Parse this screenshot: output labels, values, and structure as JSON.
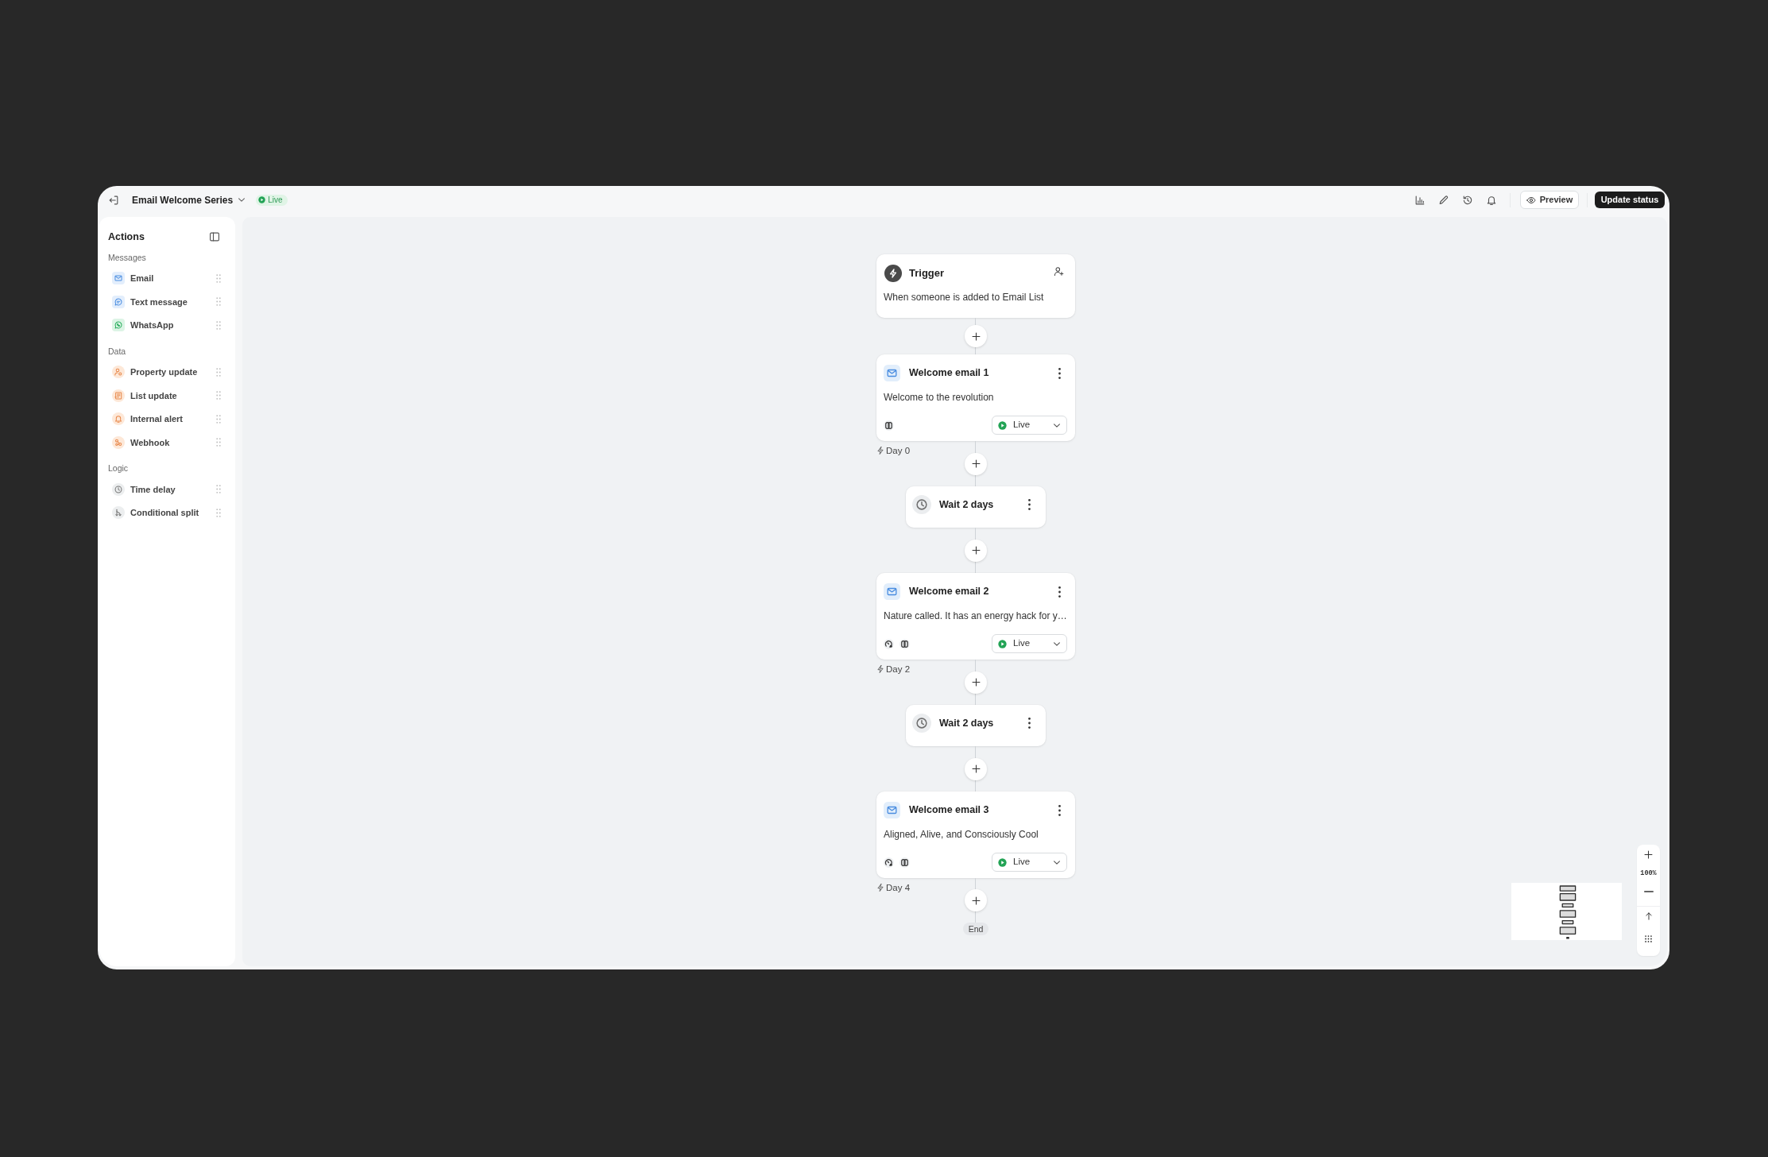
{
  "window": {
    "title": "Email Welcome Series",
    "status": "Live"
  },
  "toolbar": {
    "buttons": [
      {
        "label": "Preview",
        "kind": "preview"
      },
      {
        "label": "Update status",
        "kind": "primary"
      }
    ]
  },
  "sidebar": {
    "title": "Actions",
    "groups": [
      {
        "label": "Messages",
        "items": [
          {
            "label": "Email",
            "kind": "email"
          },
          {
            "label": "Text message",
            "kind": "sms"
          },
          {
            "label": "WhatsApp",
            "kind": "whatsapp"
          }
        ]
      },
      {
        "label": "Data",
        "items": [
          {
            "label": "Property update",
            "kind": "property"
          },
          {
            "label": "List update",
            "kind": "list"
          },
          {
            "label": "Internal alert",
            "kind": "alert"
          },
          {
            "label": "Webhook",
            "kind": "webhook"
          }
        ]
      },
      {
        "label": "Logic",
        "items": [
          {
            "label": "Time delay",
            "kind": "delay"
          },
          {
            "label": "Conditional split",
            "kind": "split"
          }
        ]
      }
    ]
  },
  "flow": {
    "nodes": [
      {
        "kind": "trigger",
        "title": "Trigger",
        "description": "When someone is added to Email List"
      },
      {
        "kind": "email",
        "title": "Welcome email 1",
        "description": "Welcome to the revolution",
        "indicators": [
          {
            "kind": "rings"
          }
        ],
        "status": "Live",
        "day": "Day 0"
      },
      {
        "kind": "wait",
        "title": "Wait 2 days"
      },
      {
        "kind": "email",
        "title": "Welcome email 2",
        "description": "Nature called. It has an energy hack for y…",
        "indicators": [
          {
            "kind": "gauge"
          },
          {
            "kind": "rings"
          }
        ],
        "status": "Live",
        "day": "Day 2"
      },
      {
        "kind": "wait",
        "title": "Wait 2 days"
      },
      {
        "kind": "email",
        "title": "Welcome email 3",
        "description": "Aligned, Alive, and Consciously Cool",
        "indicators": [
          {
            "kind": "gauge"
          },
          {
            "kind": "rings"
          }
        ],
        "status": "Live",
        "day": "Day 4"
      }
    ],
    "end": "End"
  },
  "zoom_controls": {
    "label": "100%"
  }
}
